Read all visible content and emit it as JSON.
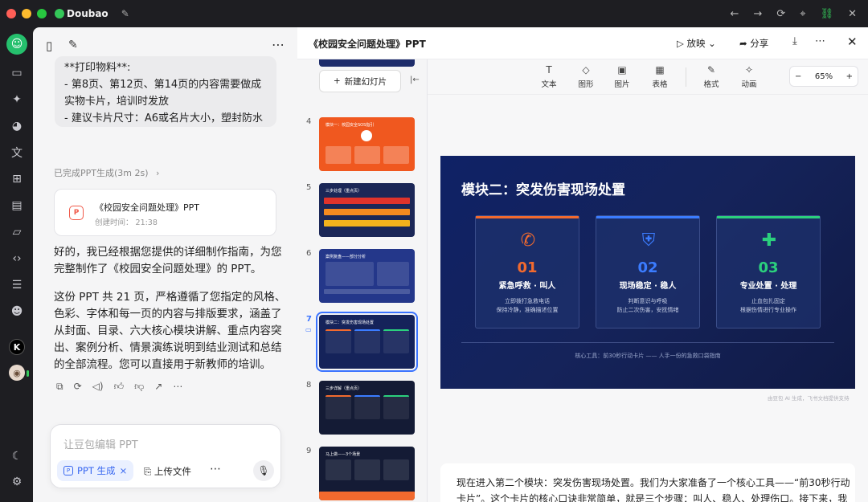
{
  "app": {
    "name": "Doubao",
    "edit_icon": "edit-icon"
  },
  "colors": {
    "close": "#ff5f57",
    "minimize": "#febc2e",
    "zoom": "#28c840",
    "brand": "#34c759",
    "accent": "#3867f0",
    "slide_bg": "#15235a",
    "orange": "#f26a2e",
    "blue": "#3b7cff",
    "green": "#2bd07d"
  },
  "titlebar": {
    "icons": [
      "←",
      "→",
      "⟳",
      "⌖",
      "⛓",
      "✕"
    ]
  },
  "rail": {
    "avatar": "◯",
    "k_label": "K",
    "user": "◉"
  },
  "chat": {
    "bubble_lines": [
      "**打印物料**:",
      "- 第8页、第12页、第14页的内容需要做成",
      "实物卡片，培训时发放",
      "- 建议卡片尺寸：A6或名片大小，塑封防水"
    ],
    "done_label": "已完成PPT生成(3m 2s)",
    "file_title": "《校园安全问题处理》PPT",
    "file_date": "创建时间： 21:38",
    "para1": [
      "好的，我已经根据您提供的详细制作指南，为您",
      "完整制作了《校园安全问题处理》的 PPT。"
    ],
    "para2": [
      "这份 PPT 共 21 页，严格遵循了您指定的风格、",
      "色彩、字体和每一页的内容与排版要求，涵盖了",
      "从封面、目录、六大核心模块讲解、重点内容突",
      "出、案例分析、情景演练说明到结业测试和总结",
      "的全部流程。您可以直接用于新教师的培训。"
    ],
    "input_placeholder": "让豆包编辑 PPT",
    "chip_label": "PPT 生成",
    "upload_label": "上传文件"
  },
  "doc": {
    "title": "《校园安全问题处理》PPT",
    "play_label": "放映",
    "share_label": "分享",
    "new_slide_label": "新建幻灯片",
    "tools": [
      {
        "label": "文本",
        "icon": "T"
      },
      {
        "label": "图形",
        "icon": "◇"
      },
      {
        "label": "图片",
        "icon": "▣"
      },
      {
        "label": "表格",
        "icon": "▦"
      },
      {
        "label": "格式",
        "icon": "✎"
      },
      {
        "label": "动画",
        "icon": "✧"
      }
    ],
    "zoom": {
      "value": "65%",
      "minus": "−",
      "plus": "+"
    },
    "thumbs": [
      {
        "num": "4",
        "head": "模块一：校园安全SOS指引"
      },
      {
        "num": "5",
        "head": "三步处理（重点页）"
      },
      {
        "num": "6",
        "head": "案例复盘——部分分析"
      },
      {
        "num": "7",
        "head": "模块二：突发伤害现场处置"
      },
      {
        "num": "8",
        "head": "三步详解（重点页）"
      },
      {
        "num": "9",
        "head": "马上做——3个场景"
      }
    ],
    "slide": {
      "title": "模块二：突发伤害现场处置",
      "cards": [
        {
          "num": "01",
          "label": "紧急呼救 · 叫人",
          "d1": "立即拨打急救电话",
          "d2": "保持冷静，准确描述位置",
          "icon": "✆"
        },
        {
          "num": "02",
          "label": "现场稳定 · 稳人",
          "d1": "判断意识与呼吸",
          "d2": "防止二次伤害，安抚情绪",
          "icon": "⛨"
        },
        {
          "num": "03",
          "label": "专业处置 · 处理",
          "d1": "止血包扎固定",
          "d2": "根据伤情进行专业操作",
          "icon": "✚"
        }
      ],
      "footer": "核心工具：前30秒行动卡片 —— 人手一份的急救口袋指南"
    },
    "ai_note": "由豆包 AI 生成，飞书文档提供支持",
    "notes": [
      "现在进入第二个模块：突发伤害现场处置。我们为大家准备了一个核心工具——“前30秒行动",
      "卡片”。这个卡片的核心口诀非常简单，就是三个步骤：叫人、稳人、处理伤口。接下来，我"
    ]
  }
}
